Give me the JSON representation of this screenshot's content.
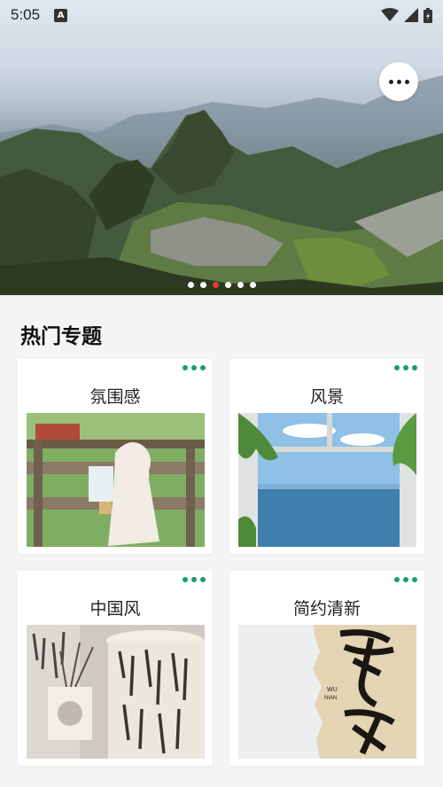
{
  "status_bar": {
    "time": "5:05"
  },
  "banner": {
    "carousel_total": 6,
    "carousel_active_index": 2
  },
  "section": {
    "title": "热门专题"
  },
  "topics": [
    {
      "label": "氛围感",
      "image": "girl-at-farm-fence-photo"
    },
    {
      "label": "风景",
      "image": "window-sea-view-photo"
    },
    {
      "label": "中国风",
      "image": "calligraphy-lamp-photo"
    },
    {
      "label": "简约清新",
      "image": "ink-calligraphy-paper-photo"
    }
  ],
  "colors": {
    "accent_green": "#1a9e6b",
    "active_dot": "#e53935"
  }
}
